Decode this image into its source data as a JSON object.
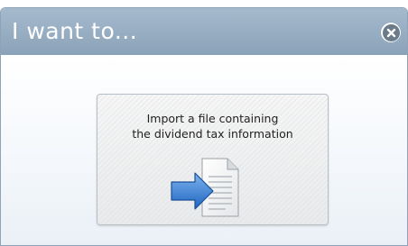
{
  "dialog": {
    "title": "I want to...",
    "close_icon": "close-circle-icon"
  },
  "option": {
    "line1": "Import a file containing",
    "line2": "the dividend tax information",
    "icon": "import-document-icon",
    "arrow_color": "#2f7ad6",
    "page_color": "#ffffff"
  }
}
